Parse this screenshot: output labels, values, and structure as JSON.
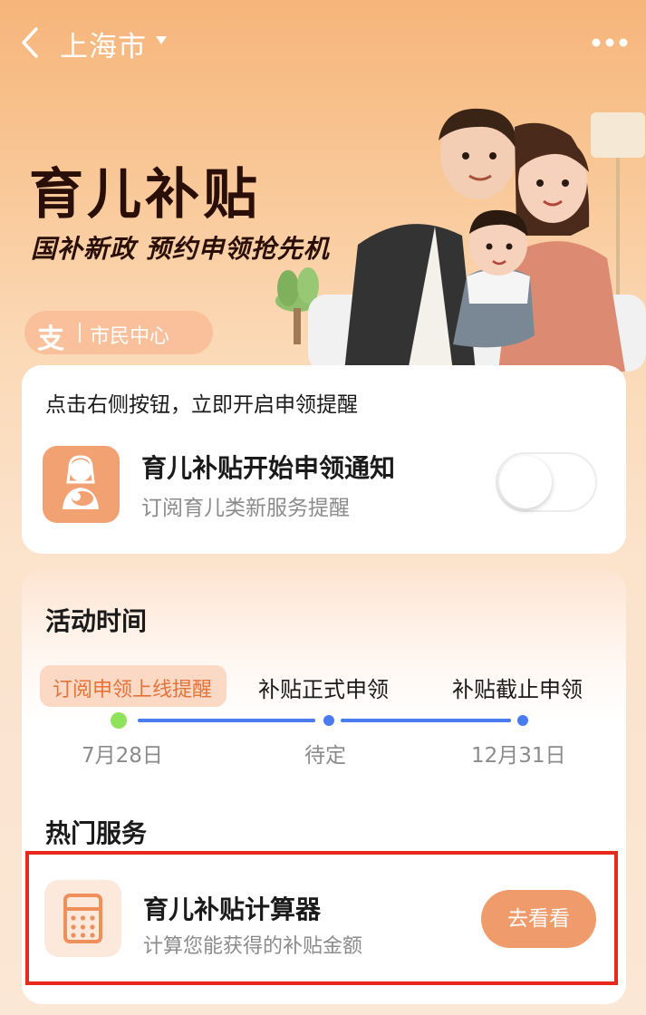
{
  "header": {
    "city": "上海市",
    "icons": {
      "back": "back-arrow-icon",
      "caret": "caret-down-icon",
      "more": "more-dots-icon"
    }
  },
  "hero": {
    "title": "育儿补贴",
    "subtitle": "国补新政  预约申领抢先机",
    "badge": {
      "logo": "支",
      "label": "市民中心"
    }
  },
  "notify_card": {
    "hint": "点击右侧按钮，立即开启申领提醒",
    "title": "育儿补贴开始申领通知",
    "subtitle": "订阅育儿类新服务提醒",
    "toggle_on": false,
    "icon": "mother-baby-icon"
  },
  "activity": {
    "title": "活动时间",
    "stages": [
      {
        "label": "订阅申领上线提醒",
        "date": "7月28日",
        "active": true
      },
      {
        "label": "补贴正式申领",
        "date": "待定",
        "active": false
      },
      {
        "label": "补贴截止申领",
        "date": "12月31日",
        "active": false
      }
    ]
  },
  "services": {
    "title": "热门服务",
    "items": [
      {
        "title": "育儿补贴计算器",
        "subtitle": "计算您能获得的补贴金额",
        "button": "去看看",
        "icon": "calculator-icon"
      }
    ]
  },
  "colors": {
    "accent": "#ef9b6b",
    "timeline_blue": "#4a7bf0",
    "active_dot": "#8fe35c",
    "highlight_red": "#e8291d"
  }
}
